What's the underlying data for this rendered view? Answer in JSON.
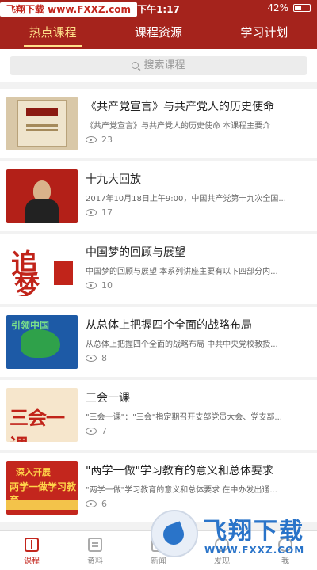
{
  "status_bar": {
    "watermark": "飞翔下载 www.FXXZ.com",
    "time": "下午1:17",
    "battery": "42%",
    "battery_level": 0.42
  },
  "tabs": [
    {
      "label": "热点课程",
      "active": true
    },
    {
      "label": "课程资源",
      "active": false
    },
    {
      "label": "学习计划",
      "active": false
    }
  ],
  "search": {
    "placeholder": "搜索课程"
  },
  "courses": [
    {
      "title": "《共产党宣言》与共产党人的历史使命",
      "desc": "《共产党宣言》与共产党人的历史使命 本课程主要介",
      "views": "23",
      "thumb": "book-cover"
    },
    {
      "title": "十九大回放",
      "desc": "2017年10月18日上午9:00，中国共产党第十九次全国...",
      "views": "17",
      "thumb": "congress-speech"
    },
    {
      "title": "中国梦的回顾与展望",
      "desc": "中国梦的回顾与展望 本系列讲座主要有以下四部分内...",
      "views": "10",
      "thumb": "calligraphy"
    },
    {
      "title": "从总体上把握四个全面的战略布局",
      "desc": "从总体上把握四个全面的战略布局 中共中央党校教授...",
      "views": "8",
      "thumb": "china-map"
    },
    {
      "title": "三会一课",
      "desc": "\"三会一课\"：\"三会\"指定期召开支部党员大会、党支部...",
      "views": "7",
      "thumb": "three-meetings"
    },
    {
      "title": "\"两学一做\"学习教育的意义和总体要求",
      "desc": "\"两学一做\"学习教育的意义和总体要求 在中办发出通...",
      "views": "6",
      "thumb": "two-studies"
    }
  ],
  "thumb_text": {
    "t3a": "追",
    "t3b": "梦",
    "t4": "引领中国",
    "t5": "三会一课",
    "t6a": "深入开展",
    "t6b": "两学一做学习教育"
  },
  "bottom_nav": [
    {
      "label": "课程",
      "icon": "book-icon",
      "active": true
    },
    {
      "label": "资料",
      "icon": "document-icon",
      "active": false
    },
    {
      "label": "新闻",
      "icon": "news-icon",
      "active": false
    },
    {
      "label": "发现",
      "icon": "discover-icon",
      "active": false
    },
    {
      "label": "我",
      "icon": "profile-icon",
      "active": false
    }
  ],
  "watermark_badge": {
    "title": "飞翔下载",
    "url": "WWW.FXXZ.COM"
  },
  "colors": {
    "brand_red": "#a5231c",
    "tab_active": "#ffe08a",
    "watermark_blue": "#2a74c9"
  }
}
